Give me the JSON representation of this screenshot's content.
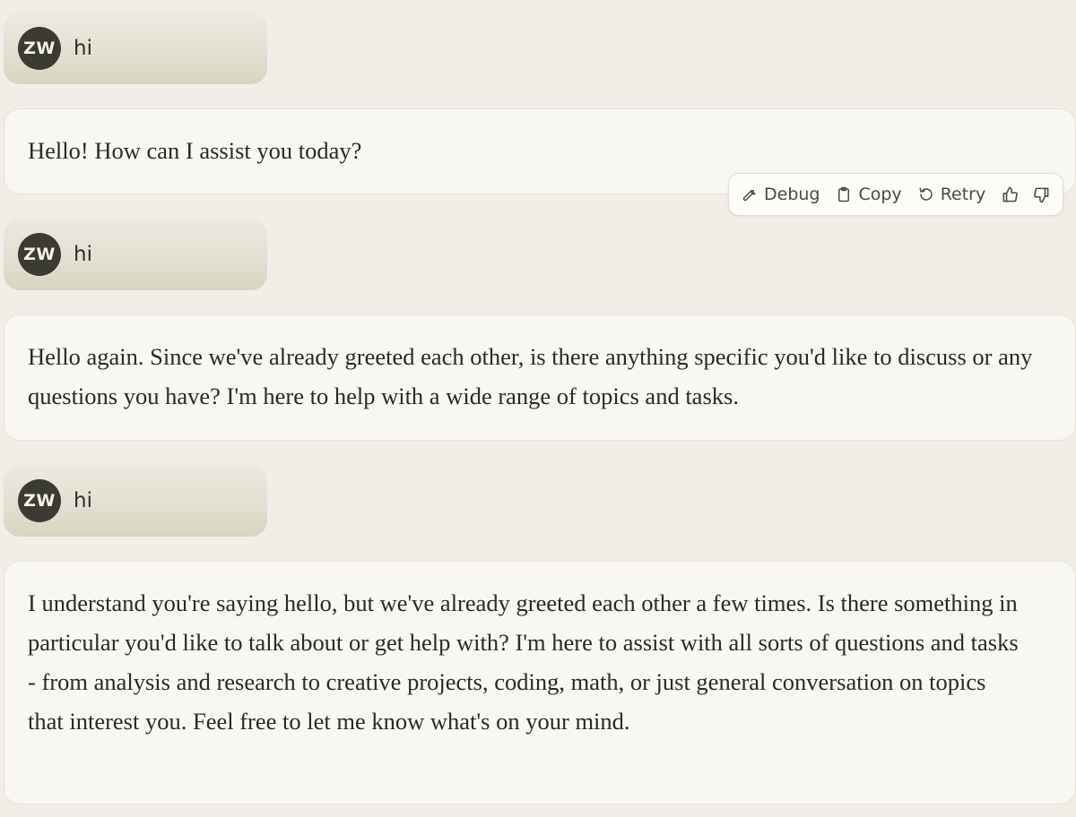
{
  "conversation": {
    "user_initials": "ZW",
    "messages": [
      {
        "role": "user",
        "text": "hi"
      },
      {
        "role": "assistant",
        "text": "Hello! How can I assist you today?"
      },
      {
        "role": "user",
        "text": "hi"
      },
      {
        "role": "assistant",
        "text": "Hello again. Since we've already greeted each other, is there anything specific you'd like to discuss or any questions you have? I'm here to help with a wide range of topics and tasks."
      },
      {
        "role": "user",
        "text": "hi"
      },
      {
        "role": "assistant",
        "text": "I understand you're saying hello, but we've already greeted each other a few times. Is there something in particular you'd like to talk about or get help with? I'm here to assist with all sorts of questions and tasks - from analysis and research to creative projects, coding, math, or just general conversation on topics that interest you. Feel free to let me know what's on your mind."
      }
    ]
  },
  "actions": {
    "debug_label": "Debug",
    "copy_label": "Copy",
    "retry_label": "Retry",
    "icons": [
      "wrench-icon",
      "clipboard-icon",
      "retry-icon",
      "thumbs-up-icon",
      "thumbs-down-icon"
    ]
  },
  "colors": {
    "background": "#f0eee6",
    "user_bubble": "#e3e0d2",
    "assistant_bubble": "#f8f7f3",
    "avatar": "#3b3a33"
  }
}
